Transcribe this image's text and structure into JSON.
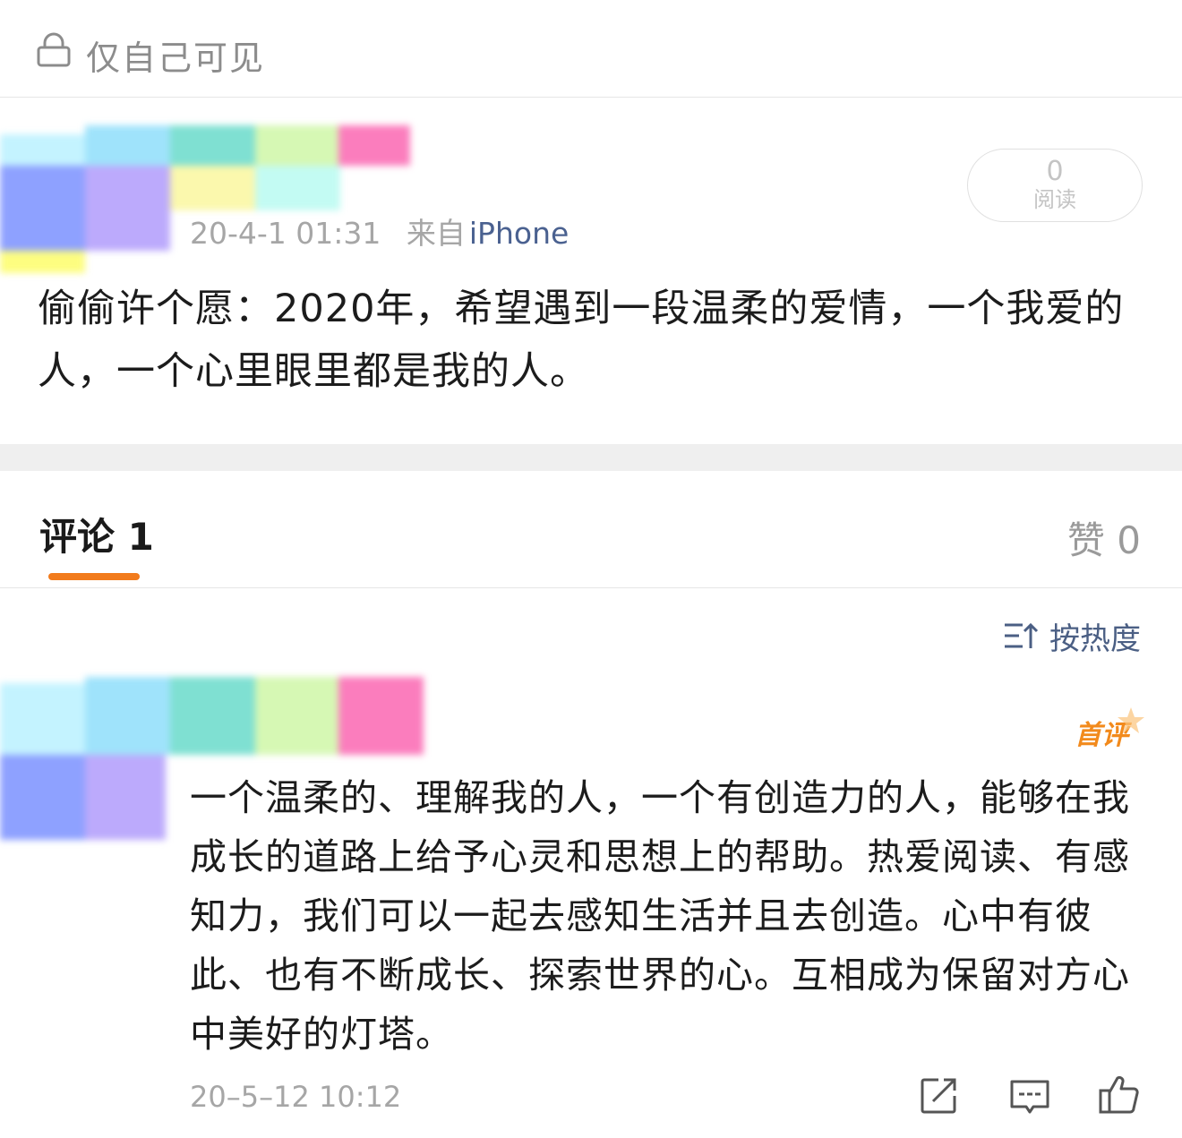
{
  "privacy": {
    "label": "仅自己可见",
    "icon": "lock-icon"
  },
  "post": {
    "time": "20-4-1 01:31",
    "source_prefix": "来自",
    "source_device": "iPhone",
    "read_count": "0",
    "read_label": "阅读",
    "text": "偷偷许个愿：2020年，希望遇到一段温柔的爱情，一个我爱的人，一个心里眼里都是我的人。"
  },
  "tabs": {
    "comments": "评论 1",
    "likes": "赞 0"
  },
  "sort": {
    "label": "按热度",
    "icon": "sort-icon"
  },
  "comment": {
    "badge": "首评",
    "text": "一个温柔的、理解我的人，一个有创造力的人，能够在我成长的道路上给予心灵和思想上的帮助。热爱阅读、有感知力，我们可以一起去感知生活并且去创造。心中有彼此、也有不断成长、探索世界的心。互相成为保留对方心中美好的灯塔。",
    "time": "20–5–12 10:12",
    "actions": [
      "share-icon",
      "comment-icon",
      "like-icon"
    ]
  },
  "colors": {
    "accent_orange": "#f27b1c",
    "link_blue": "#4a6190",
    "meta_gray": "#a6a6a6",
    "separator": "#efefef"
  }
}
